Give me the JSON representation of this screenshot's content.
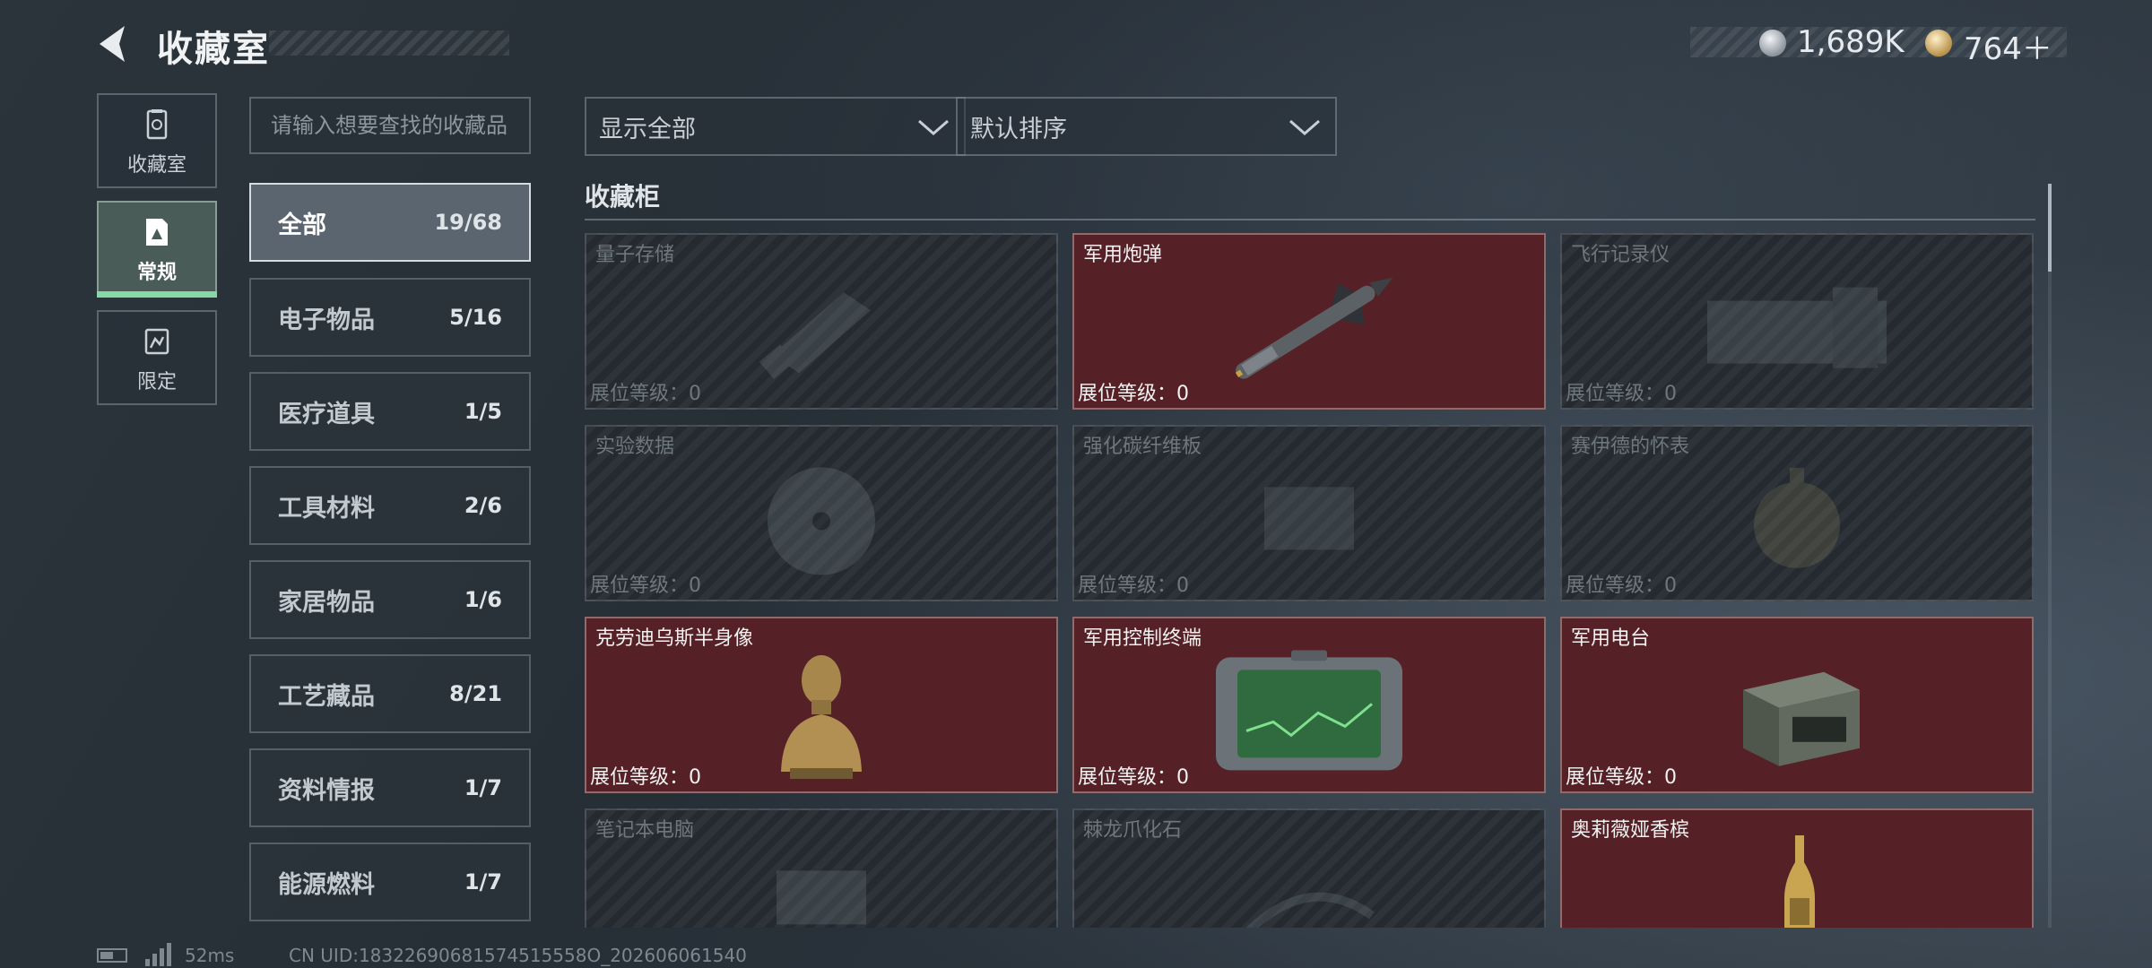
{
  "header": {
    "title": "收藏室",
    "currency": [
      {
        "icon": "silver-coin-icon",
        "value": "1,689K"
      },
      {
        "icon": "gold-coin-icon",
        "value": "764＋"
      }
    ]
  },
  "mode_tabs": [
    {
      "label": "收藏室",
      "icon": "collection-room-icon",
      "active": false
    },
    {
      "label": "常规",
      "icon": "regular-icon",
      "active": true
    },
    {
      "label": "限定",
      "icon": "limited-icon",
      "active": false
    }
  ],
  "search": {
    "placeholder": "请输入想要查找的收藏品"
  },
  "categories": [
    {
      "name": "全部",
      "count": "19/68",
      "active": true
    },
    {
      "name": "电子物品",
      "count": "5/16"
    },
    {
      "name": "医疗道具",
      "count": "1/5"
    },
    {
      "name": "工具材料",
      "count": "2/6"
    },
    {
      "name": "家居物品",
      "count": "1/6"
    },
    {
      "name": "工艺藏品",
      "count": "8/21"
    },
    {
      "name": "资料情报",
      "count": "1/7"
    },
    {
      "name": "能源燃料",
      "count": "1/7"
    }
  ],
  "filters": {
    "display": "显示全部",
    "sort": "默认排序"
  },
  "cabinet": {
    "title": "收藏柜",
    "items": [
      {
        "name": "量子存储",
        "level": "展位等级：0",
        "owned": false,
        "icon": "usb-drive-icon"
      },
      {
        "name": "军用炮弹",
        "level": "展位等级：0",
        "owned": true,
        "icon": "missile-icon"
      },
      {
        "name": "飞行记录仪",
        "level": "展位等级：0",
        "owned": false,
        "icon": "flight-recorder-icon"
      },
      {
        "name": "实验数据",
        "level": "展位等级：0",
        "owned": false,
        "icon": "data-disc-icon"
      },
      {
        "name": "强化碳纤维板",
        "level": "展位等级：0",
        "owned": false,
        "icon": "carbon-plate-icon"
      },
      {
        "name": "赛伊德的怀表",
        "level": "展位等级：0",
        "owned": false,
        "icon": "pocket-watch-icon"
      },
      {
        "name": "克劳迪乌斯半身像",
        "level": "展位等级：0",
        "owned": true,
        "icon": "bust-icon"
      },
      {
        "name": "军用控制终端",
        "level": "展位等级：0",
        "owned": true,
        "icon": "control-terminal-icon"
      },
      {
        "name": "军用电台",
        "level": "展位等级：0",
        "owned": true,
        "icon": "radio-icon"
      },
      {
        "name": "笔记本电脑",
        "level": "",
        "owned": false,
        "icon": "laptop-icon"
      },
      {
        "name": "棘龙爪化石",
        "level": "",
        "owned": false,
        "icon": "fossil-icon"
      },
      {
        "name": "奥莉薇娅香槟",
        "level": "",
        "owned": true,
        "icon": "champagne-icon"
      }
    ]
  },
  "footer": {
    "ping": "52ms",
    "uid": "CN UID:18322690681574515558O_202606061540"
  }
}
